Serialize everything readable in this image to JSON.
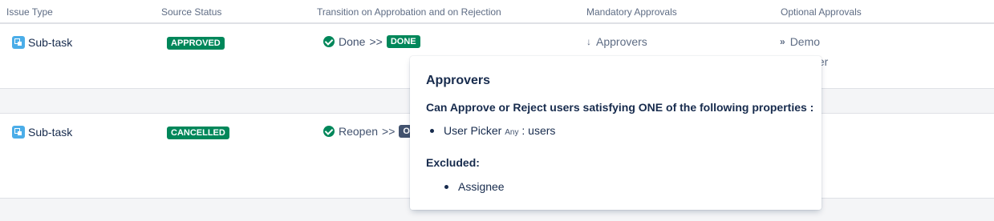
{
  "header": {
    "col_issue_type": "Issue Type",
    "col_source_status": "Source Status",
    "col_transition": "Transition on Approbation and on Rejection",
    "col_mandatory": "Mandatory Approvals",
    "col_optional": "Optional Approvals"
  },
  "rows": [
    {
      "issue_type": "Sub-task",
      "source_status": "APPROVED",
      "transition_link": "Done",
      "transition_arrow": ">>",
      "target_status": "DONE",
      "mandatory": "Approvers",
      "optional": "Demo",
      "optional_second": "ter"
    },
    {
      "issue_type": "Sub-task",
      "source_status": "CANCELLED",
      "transition_link": "Reopen",
      "transition_arrow": ">>",
      "target_status": "O"
    }
  ],
  "popup": {
    "title": "Approvers",
    "description": "Can Approve or Reject users satisfying ONE of the following properties :",
    "properties": [
      {
        "label": "User Picker",
        "qualifier": "Any",
        "value": ": users"
      }
    ],
    "excluded_title": "Excluded:",
    "excluded": [
      "Assignee"
    ]
  },
  "colors": {
    "status_green": "#00875a",
    "status_grey": "#42526e",
    "border": "#dfe1e6",
    "background": "#f4f5f7"
  },
  "icons": [
    "subtask-icon",
    "check-circle-icon",
    "chevron-double-down-icon",
    "chevron-double-right-icon"
  ]
}
